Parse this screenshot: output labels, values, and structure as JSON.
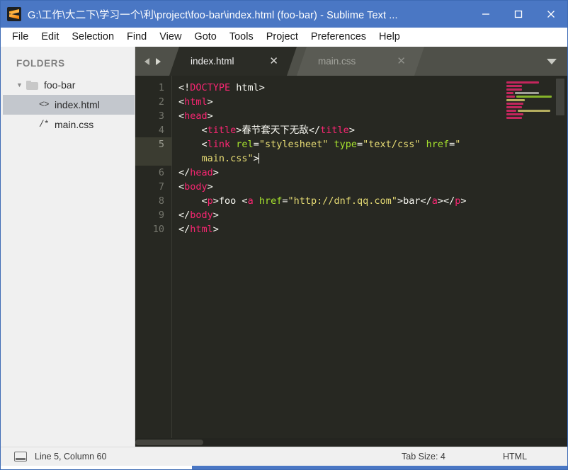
{
  "window": {
    "title": "G:\\工作\\大二下\\学习一个\\利\\project\\foo-bar\\index.html (foo-bar) - Sublime Text ...",
    "app_icon": "sublime-text-icon",
    "controls": {
      "minimize": "minimize-icon",
      "maximize": "maximize-icon",
      "close": "close-icon"
    },
    "titlebar_color": "#4a77c4"
  },
  "menu": {
    "items": [
      "File",
      "Edit",
      "Selection",
      "Find",
      "View",
      "Goto",
      "Tools",
      "Project",
      "Preferences",
      "Help"
    ]
  },
  "sidebar": {
    "header": "FOLDERS",
    "folder": {
      "name": "foo-bar",
      "expanded_arrow": "chevron-down-icon",
      "icon": "folder-icon"
    },
    "files": [
      {
        "name": "index.html",
        "icon_text": "<>",
        "selected": true
      },
      {
        "name": "main.css",
        "icon_text": "/*",
        "selected": false
      }
    ]
  },
  "tabs": {
    "nav_prev": "arrow-left-icon",
    "nav_next": "arrow-right-icon",
    "menu_icon": "chevron-down-icon",
    "close_glyph": "✕",
    "items": [
      {
        "label": "index.html",
        "active": true
      },
      {
        "label": "main.css",
        "active": false
      }
    ]
  },
  "editor": {
    "gutter": [
      "1",
      "2",
      "3",
      "4",
      "5",
      "",
      "6",
      "7",
      "8",
      "9",
      "10"
    ],
    "active_line_number": "5",
    "lines": [
      [
        {
          "t": "<!",
          "c": "tok-punct"
        },
        {
          "t": "DOCTYPE",
          "c": "tok-tag"
        },
        {
          "t": " html>",
          "c": "tok-plain"
        }
      ],
      [
        {
          "t": "<",
          "c": "tok-punct"
        },
        {
          "t": "html",
          "c": "tok-tag"
        },
        {
          "t": ">",
          "c": "tok-punct"
        }
      ],
      [
        {
          "t": "<",
          "c": "tok-punct"
        },
        {
          "t": "head",
          "c": "tok-tag"
        },
        {
          "t": ">",
          "c": "tok-punct"
        }
      ],
      [
        {
          "t": "    <",
          "c": "tok-punct"
        },
        {
          "t": "title",
          "c": "tok-tag"
        },
        {
          "t": ">春节套天下无敌</",
          "c": "tok-plain"
        },
        {
          "t": "title",
          "c": "tok-tag"
        },
        {
          "t": ">",
          "c": "tok-punct"
        }
      ],
      [
        {
          "t": "    <",
          "c": "tok-punct"
        },
        {
          "t": "link",
          "c": "tok-tag"
        },
        {
          "t": " ",
          "c": "tok-plain"
        },
        {
          "t": "rel",
          "c": "tok-attr"
        },
        {
          "t": "=",
          "c": "tok-plain"
        },
        {
          "t": "\"stylesheet\"",
          "c": "tok-str"
        },
        {
          "t": " ",
          "c": "tok-plain"
        },
        {
          "t": "type",
          "c": "tok-attr"
        },
        {
          "t": "=",
          "c": "tok-plain"
        },
        {
          "t": "\"text/css\"",
          "c": "tok-str"
        },
        {
          "t": " ",
          "c": "tok-plain"
        },
        {
          "t": "href",
          "c": "tok-attr"
        },
        {
          "t": "=",
          "c": "tok-plain"
        },
        {
          "t": "\"",
          "c": "tok-str"
        }
      ],
      [
        {
          "t": "    ",
          "c": "tok-plain"
        },
        {
          "t": "main.css\"",
          "c": "tok-str"
        },
        {
          "t": ">",
          "c": "tok-punct"
        }
      ],
      [
        {
          "t": "</",
          "c": "tok-punct"
        },
        {
          "t": "head",
          "c": "tok-tag"
        },
        {
          "t": ">",
          "c": "tok-punct"
        }
      ],
      [
        {
          "t": "<",
          "c": "tok-punct"
        },
        {
          "t": "body",
          "c": "tok-tag"
        },
        {
          "t": ">",
          "c": "tok-punct"
        }
      ],
      [
        {
          "t": "    <",
          "c": "tok-punct"
        },
        {
          "t": "p",
          "c": "tok-tag"
        },
        {
          "t": ">foo <",
          "c": "tok-plain"
        },
        {
          "t": "a",
          "c": "tok-tag"
        },
        {
          "t": " ",
          "c": "tok-plain"
        },
        {
          "t": "href",
          "c": "tok-attr"
        },
        {
          "t": "=",
          "c": "tok-plain"
        },
        {
          "t": "\"http://dnf.qq.com\"",
          "c": "tok-str"
        },
        {
          "t": ">bar</",
          "c": "tok-plain"
        },
        {
          "t": "a",
          "c": "tok-tag"
        },
        {
          "t": "></",
          "c": "tok-plain"
        },
        {
          "t": "p",
          "c": "tok-tag"
        },
        {
          "t": ">",
          "c": "tok-punct"
        }
      ],
      [
        {
          "t": "</",
          "c": "tok-punct"
        },
        {
          "t": "body",
          "c": "tok-tag"
        },
        {
          "t": ">",
          "c": "tok-punct"
        }
      ],
      [
        {
          "t": "</",
          "c": "tok-punct"
        },
        {
          "t": "html",
          "c": "tok-tag"
        },
        {
          "t": ">",
          "c": "tok-punct"
        }
      ]
    ],
    "colors": {
      "background": "#272822",
      "tag": "#f92672",
      "attribute": "#a6e22e",
      "string": "#e6db74",
      "text": "#f8f8f2",
      "line_number": "#75766d",
      "active_line_gutter": "#3b3c31"
    }
  },
  "minimap": {
    "rows": [
      [
        {
          "w": 46,
          "color": "#f92672"
        }
      ],
      [
        {
          "w": 22,
          "color": "#f92672"
        }
      ],
      [
        {
          "w": 22,
          "color": "#f92672"
        }
      ],
      [
        {
          "w": 10,
          "color": "#f92672"
        },
        {
          "w": 34,
          "color": "#c8c8c0"
        }
      ],
      [
        {
          "w": 12,
          "color": "#f92672"
        },
        {
          "w": 50,
          "color": "#a6e22e"
        }
      ],
      [
        {
          "w": 26,
          "color": "#e6db74"
        }
      ],
      [
        {
          "w": 24,
          "color": "#f92672"
        }
      ],
      [
        {
          "w": 22,
          "color": "#f92672"
        }
      ],
      [
        {
          "w": 14,
          "color": "#f92672"
        },
        {
          "w": 46,
          "color": "#e6db74"
        }
      ],
      [
        {
          "w": 24,
          "color": "#f92672"
        }
      ],
      [
        {
          "w": 22,
          "color": "#f92672"
        }
      ]
    ]
  },
  "statusbar": {
    "icon": "display-icon",
    "cursor_position": "Line 5, Column 60",
    "tab_size": "Tab Size: 4",
    "syntax": "HTML"
  }
}
